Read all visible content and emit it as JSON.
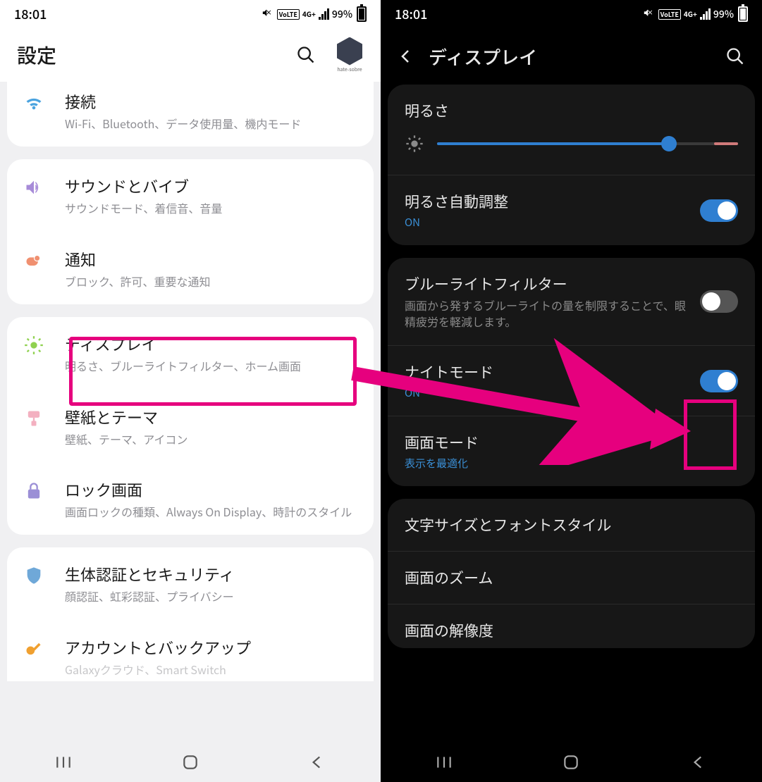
{
  "status": {
    "time": "18:01",
    "volte": "VoLTE",
    "net": "4G+",
    "battery": "99%"
  },
  "left": {
    "title": "設定",
    "avatar_caption": "hate-sobre",
    "items": [
      {
        "icon": "wifi",
        "title": "接続",
        "sub": "Wi-Fi、Bluetooth、データ使用量、機内モード"
      },
      {
        "icon": "sound",
        "title": "サウンドとバイブ",
        "sub": "サウンドモード、着信音、音量"
      },
      {
        "icon": "notif",
        "title": "通知",
        "sub": "ブロック、許可、重要な通知"
      },
      {
        "icon": "display",
        "title": "ディスプレイ",
        "sub": "明るさ、ブルーライトフィルター、ホーム画面"
      },
      {
        "icon": "wall",
        "title": "壁紙とテーマ",
        "sub": "壁紙、テーマ、アイコン"
      },
      {
        "icon": "lock",
        "title": "ロック画面",
        "sub": "画面ロックの種類、Always On Display、時計のスタイル"
      },
      {
        "icon": "bio",
        "title": "生体認証とセキュリティ",
        "sub": "顔認証、虹彩認証、プライバシー"
      },
      {
        "icon": "acct",
        "title": "アカウントとバックアップ",
        "sub": "Galaxyクラウド、Smart Switch"
      }
    ]
  },
  "right": {
    "title": "ディスプレイ",
    "brightness_label": "明るさ",
    "auto_bright": {
      "title": "明るさ自動調整",
      "status": "ON",
      "on": true
    },
    "bluelight": {
      "title": "ブルーライトフィルター",
      "sub": "画面から発するブルーライトの量を制限することで、眼精疲労を軽減します。",
      "on": false
    },
    "nightmode": {
      "title": "ナイトモード",
      "status": "ON",
      "on": true
    },
    "screenmode": {
      "title": "画面モード",
      "status": "表示を最適化"
    },
    "font": {
      "title": "文字サイズとフォントスタイル"
    },
    "zoom": {
      "title": "画面のズーム"
    },
    "resolution": {
      "title": "画面の解像度"
    }
  }
}
